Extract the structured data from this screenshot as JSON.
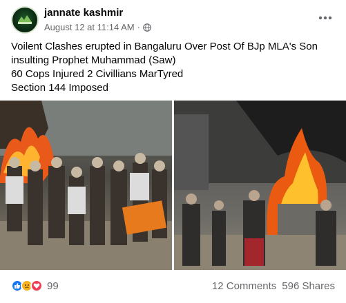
{
  "post": {
    "page_name": "jannate kashmir",
    "date": "August 12 at 11:14 AM",
    "separator": "·",
    "icons": {
      "avatar": "page-logo",
      "privacy": "globe-icon",
      "menu": "more-horizontal-icon"
    },
    "text_lines": [
      "Voilent Clashes erupted in Bangaluru Over Post Of BJp MLA's Son",
      "insulting Prophet Muhammad (Saw)",
      "60 Cops Injured 2 Civillians MarTyred",
      "Section 144 Imposed"
    ],
    "reactions": {
      "types": [
        "like-icon",
        "sad-icon",
        "love-icon"
      ],
      "count": "99"
    },
    "comments": "12 Comments",
    "shares": "596 Shares"
  },
  "colors": {
    "like": "#1877f2",
    "sad": "#f7b125",
    "love": "#f33e58",
    "secondary_text": "#65676b"
  }
}
